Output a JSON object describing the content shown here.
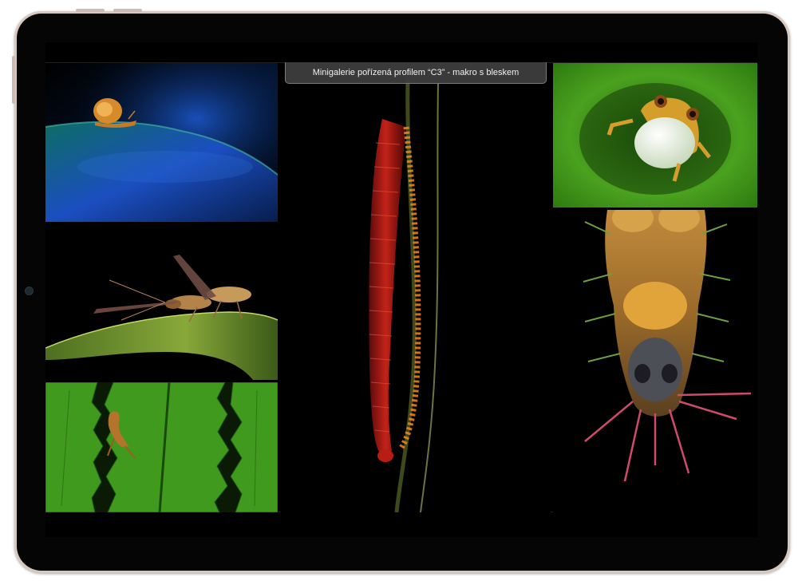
{
  "gallery": {
    "caption": "Minigalerie pořízená profilem “C3” - makro s bleskem",
    "photos": [
      {
        "subject": "snail-on-leaf"
      },
      {
        "subject": "wasp-on-leaf"
      },
      {
        "subject": "frog-on-fern"
      },
      {
        "subject": "millipede-on-stem"
      },
      {
        "subject": "calling-frog"
      },
      {
        "subject": "spiny-caterpillar"
      }
    ]
  }
}
